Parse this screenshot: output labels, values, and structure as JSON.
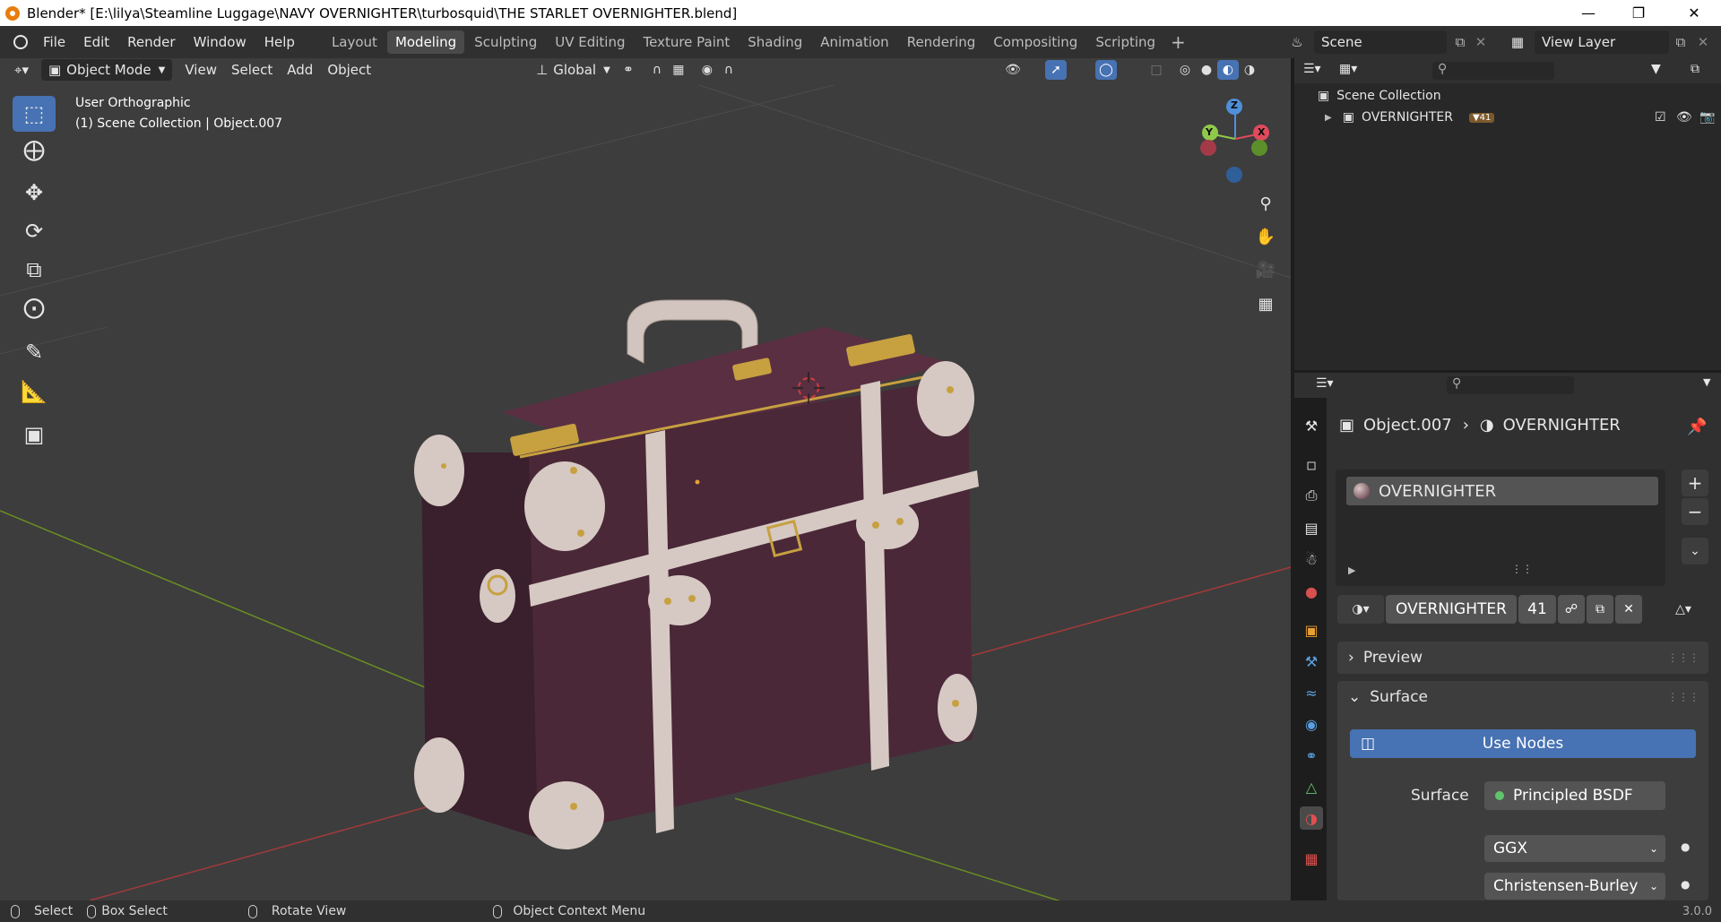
{
  "window": {
    "title": "Blender* [E:\\lilya\\Steamline Luggage\\NAVY OVERNIGHTER\\turbosquid\\THE STARLET OVERNIGHTER.blend]"
  },
  "menu": [
    "File",
    "Edit",
    "Render",
    "Window",
    "Help"
  ],
  "workspaces": [
    "Layout",
    "Modeling",
    "Sculpting",
    "UV Editing",
    "Texture Paint",
    "Shading",
    "Animation",
    "Rendering",
    "Compositing",
    "Scripting"
  ],
  "active_workspace": "Modeling",
  "scene": {
    "name": "Scene",
    "view_layer": "View Layer"
  },
  "viewport": {
    "mode": "Object Mode",
    "menus": [
      "View",
      "Select",
      "Add",
      "Object"
    ],
    "transform_orientation": "Global",
    "view_name": "User Orthographic",
    "collection_info": "(1) Scene Collection | Object.007",
    "gizmo_labels": {
      "z": "Z",
      "y": "Y",
      "x": "X"
    }
  },
  "outliner": {
    "root": "Scene Collection",
    "items": [
      {
        "name": "OVERNIGHTER",
        "count": "41"
      }
    ]
  },
  "properties": {
    "breadcrumb_object": "Object.007",
    "breadcrumb_material": "OVERNIGHTER",
    "slot_name": "OVERNIGHTER",
    "material_name": "OVERNIGHTER",
    "material_users": "41",
    "panels": {
      "preview": "Preview",
      "surface": "Surface"
    },
    "use_nodes": "Use Nodes",
    "surface_label": "Surface",
    "surface_shader": "Principled BSDF",
    "distribution": "GGX",
    "subsurface_method": "Christensen-Burley"
  },
  "status": {
    "select": "Select",
    "box_select": "Box Select",
    "rotate_view": "Rotate View",
    "context_menu": "Object Context Menu",
    "version": "3.0.0"
  },
  "colors": {
    "accent": "#4772b3",
    "viewport_bg": "#3d3d3d",
    "suitcase_body": "#4a2838",
    "trim": "#d6c9c3",
    "brass": "#c7a040"
  }
}
